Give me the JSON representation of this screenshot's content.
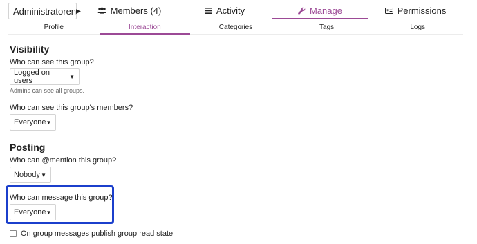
{
  "group_selector": {
    "label": "Administratoren"
  },
  "nav_tabs": {
    "members": "Members (4)",
    "activity": "Activity",
    "manage": "Manage",
    "permissions": "Permissions"
  },
  "sub_tabs": {
    "profile": "Profile",
    "interaction": "Interaction",
    "categories": "Categories",
    "tags": "Tags",
    "logs": "Logs"
  },
  "visibility": {
    "heading": "Visibility",
    "see_group_label": "Who can see this group?",
    "see_group_value": "Logged on users",
    "see_group_hint": "Admins can see all groups.",
    "see_members_label": "Who can see this group's members?",
    "see_members_value": "Everyone"
  },
  "posting": {
    "heading": "Posting",
    "mention_label": "Who can @mention this group?",
    "mention_value": "Nobody",
    "message_label": "Who can message this group?",
    "message_value": "Everyone",
    "read_state_label": "On group messages publish group read state"
  },
  "colors": {
    "accent": "#9c4a96",
    "highlight": "#1b3fcc"
  }
}
